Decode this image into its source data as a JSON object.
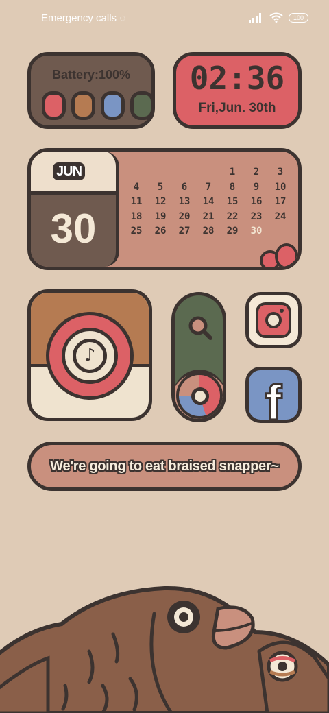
{
  "status_bar": {
    "carrier_text": "Emergency calls",
    "battery_level": "100"
  },
  "battery_widget": {
    "label": "Battery:100%",
    "colors": [
      "#dc6166",
      "#b57b52",
      "#7a95c4",
      "#5b6a50"
    ]
  },
  "clock_widget": {
    "time": "02:36",
    "date": "Fri,Jun. 30th"
  },
  "calendar_widget": {
    "month": "JUN",
    "day": "30",
    "weeks": [
      [
        "",
        "",
        "",
        "",
        "1",
        "2",
        "3"
      ],
      [
        "4",
        "5",
        "6",
        "7",
        "8",
        "9",
        "10"
      ],
      [
        "11",
        "12",
        "13",
        "14",
        "15",
        "16",
        "17"
      ],
      [
        "18",
        "19",
        "20",
        "21",
        "22",
        "23",
        "24"
      ],
      [
        "25",
        "26",
        "27",
        "28",
        "29",
        "30",
        ""
      ]
    ],
    "today": "30"
  },
  "apps": {
    "music": "music-note-icon",
    "search": "search-icon",
    "browser": "chrome-icon",
    "instagram": "instagram-icon",
    "facebook": "facebook-icon",
    "facebook_glyph": "f"
  },
  "message_widget": {
    "text": "We're going to eat braised snapper~"
  },
  "colors": {
    "background": "#dfcbb6",
    "outline": "#3c3330",
    "red": "#dc6166",
    "brown": "#6f5a4f",
    "salmon": "#c9907e",
    "green": "#5b6a50",
    "blue": "#7a95c4",
    "cream": "#efe3cf"
  }
}
